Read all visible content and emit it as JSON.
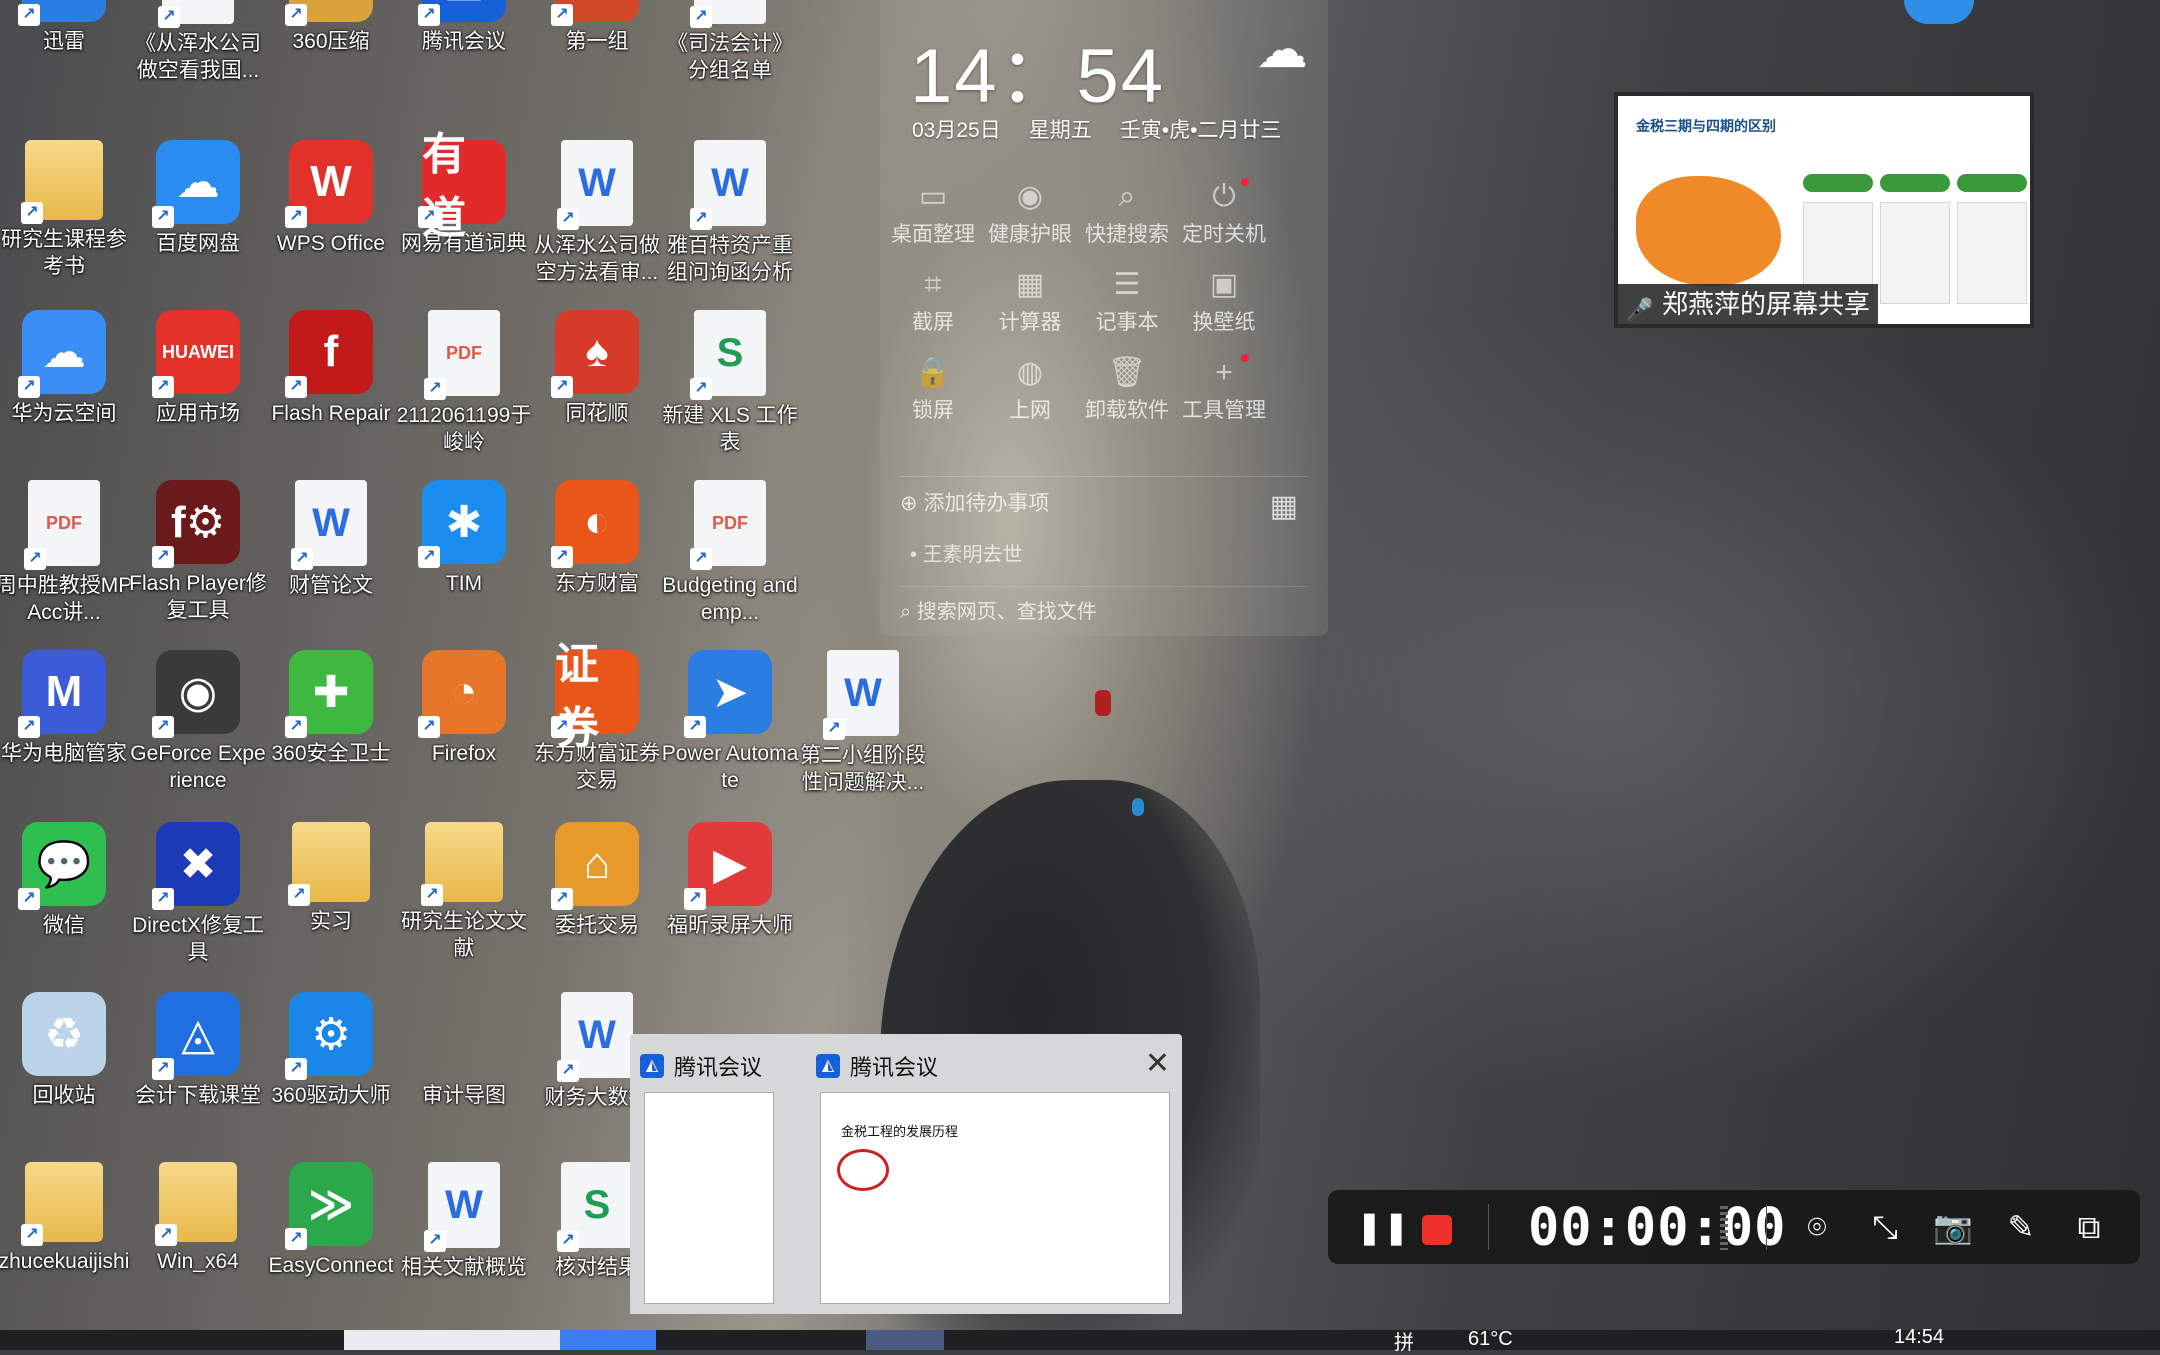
{
  "desktop_icons": [
    {
      "label": "迅雷",
      "icon": "xunlei-icon",
      "color": "#2a7de1",
      "glyph": "➤"
    },
    {
      "label": "《从浑水公司做空看我国...",
      "icon": "word-doc-icon",
      "color": "#2b6ce0",
      "glyph": "W"
    },
    {
      "label": "360压缩",
      "icon": "360zip-icon",
      "color": "#d9a23a",
      "glyph": "ZIP"
    },
    {
      "label": "腾讯会议",
      "icon": "tencent-meeting-icon",
      "color": "#1660d8",
      "glyph": "◭"
    },
    {
      "label": "第一组",
      "icon": "ppt-icon",
      "color": "#d24726",
      "glyph": "P"
    },
    {
      "label": "《司法会计》分组名单",
      "icon": "excel-doc-icon",
      "color": "#1f9d55",
      "glyph": "S"
    },
    {
      "label": "研究生课程参考书",
      "icon": "folder-icon",
      "color": "#e8b94a",
      "glyph": ""
    },
    {
      "label": "百度网盘",
      "icon": "baidu-netdisk-icon",
      "color": "#2a8cf0",
      "glyph": "☁"
    },
    {
      "label": "WPS Office",
      "icon": "wps-icon",
      "color": "#e0322b",
      "glyph": "W"
    },
    {
      "label": "网易有道词典",
      "icon": "youdao-icon",
      "color": "#e32a2a",
      "glyph": "有道"
    },
    {
      "label": "从浑水公司做空方法看审...",
      "icon": "word-doc-icon",
      "color": "#2b6ce0",
      "glyph": "W"
    },
    {
      "label": "雅百特资产重组问询函分析",
      "icon": "word-doc-icon",
      "color": "#2b6ce0",
      "glyph": "W"
    },
    {
      "label": "华为云空间",
      "icon": "huawei-cloud-icon",
      "color": "#3a8ef6",
      "glyph": "☁"
    },
    {
      "label": "应用市场",
      "icon": "huawei-appmarket-icon",
      "color": "#e4322b",
      "glyph": "HUAWEI"
    },
    {
      "label": "Flash Repair",
      "icon": "flash-repair-icon",
      "color": "#c21a1a",
      "glyph": "f"
    },
    {
      "label": "2112061199于峻岭",
      "icon": "pdf-icon",
      "color": "#e05a4a",
      "glyph": "PDF"
    },
    {
      "label": "同花顺",
      "icon": "tonghuashun-icon",
      "color": "#d83a2a",
      "glyph": "♠"
    },
    {
      "label": "新建 XLS 工作表",
      "icon": "excel-doc-icon",
      "color": "#1f9d55",
      "glyph": "S"
    },
    {
      "label": "周中胜教授MPAcc讲...",
      "icon": "pdf-icon",
      "color": "#e05a4a",
      "glyph": "PDF"
    },
    {
      "label": "Flash Player修复工具",
      "icon": "flash-player-repair-icon",
      "color": "#6a1a1a",
      "glyph": "f⚙"
    },
    {
      "label": "财管论文",
      "icon": "word-doc-icon",
      "color": "#2b6ce0",
      "glyph": "W"
    },
    {
      "label": "TIM",
      "icon": "tim-icon",
      "color": "#1b8cf0",
      "glyph": "✱"
    },
    {
      "label": "东方财富",
      "icon": "eastmoney-icon",
      "color": "#e8561a",
      "glyph": "◐"
    },
    {
      "label": "Budgeting and emp...",
      "icon": "pdf-icon",
      "color": "#e05a4a",
      "glyph": "PDF"
    },
    {
      "label": "华为电脑管家",
      "icon": "huawei-pc-manager-icon",
      "color": "#3b5bd8",
      "glyph": "M"
    },
    {
      "label": "GeForce Experience",
      "icon": "geforce-icon",
      "color": "#3a3a3a",
      "glyph": "◉"
    },
    {
      "label": "360安全卫士",
      "icon": "360-safe-icon",
      "color": "#3fb83f",
      "glyph": "✚"
    },
    {
      "label": "Firefox",
      "icon": "firefox-icon",
      "color": "#e8762a",
      "glyph": "◔"
    },
    {
      "label": "东方财富证券交易",
      "icon": "eastmoney-securities-icon",
      "color": "#e8561a",
      "glyph": "证券"
    },
    {
      "label": "Power Automate",
      "icon": "power-automate-icon",
      "color": "#2a7de1",
      "glyph": "➤"
    },
    {
      "label": "第二小组阶段性问题解决...",
      "icon": "word-doc-icon",
      "color": "#2b6ce0",
      "glyph": "W"
    },
    {
      "label": "微信",
      "icon": "wechat-icon",
      "color": "#2fbf50",
      "glyph": "💬"
    },
    {
      "label": "DirectX修复工具",
      "icon": "directx-repair-icon",
      "color": "#1a3ab8",
      "glyph": "✖"
    },
    {
      "label": "实习",
      "icon": "folder-icon",
      "color": "#e8b94a",
      "glyph": ""
    },
    {
      "label": "研究生论文文献",
      "icon": "folder-icon",
      "color": "#e8b94a",
      "glyph": ""
    },
    {
      "label": "委托交易",
      "icon": "entrust-trade-icon",
      "color": "#e89a2a",
      "glyph": "⌂"
    },
    {
      "label": "福昕录屏大师",
      "icon": "foxit-recorder-icon",
      "color": "#e23a3a",
      "glyph": "▶"
    },
    {
      "label": "回收站",
      "icon": "recycle-bin-icon",
      "color": "#bcd4ea",
      "glyph": "♻"
    },
    {
      "label": "会计下载课堂",
      "icon": "accounting-class-icon",
      "color": "#1f6fe0",
      "glyph": "◬"
    },
    {
      "label": "360驱动大师",
      "icon": "360-driver-icon",
      "color": "#1a86e8",
      "glyph": "⚙"
    },
    {
      "label": "审计导图",
      "icon": "blank-icon",
      "color": "transparent",
      "glyph": ""
    },
    {
      "label": "财务大数据",
      "icon": "word-doc-icon",
      "color": "#2b6ce0",
      "glyph": "W"
    },
    {
      "label": "zhucekuaijishi",
      "icon": "folder-icon",
      "color": "#e8b94a",
      "glyph": ""
    },
    {
      "label": "Win_x64",
      "icon": "folder-icon",
      "color": "#e8b94a",
      "glyph": ""
    },
    {
      "label": "EasyConnect",
      "icon": "easyconnect-icon",
      "color": "#2aa84a",
      "glyph": "≫"
    },
    {
      "label": "相关文献概览",
      "icon": "word-doc-icon",
      "color": "#2b6ce0",
      "glyph": "W"
    },
    {
      "label": "核对结果",
      "icon": "excel-doc-icon",
      "color": "#1f9d55",
      "glyph": "S"
    }
  ],
  "widget": {
    "time": "14：54",
    "date": "03月25日",
    "weekday": "星期五",
    "lunar": "壬寅•虎•二月廿三",
    "tools": [
      {
        "label": "桌面整理",
        "icon": "desktop-organize-icon",
        "glyph": "▭"
      },
      {
        "label": "健康护眼",
        "icon": "eye-care-icon",
        "glyph": "◉"
      },
      {
        "label": "快捷搜索",
        "icon": "search-icon",
        "glyph": "⌕"
      },
      {
        "label": "定时关机",
        "icon": "power-icon",
        "glyph": "⏻"
      },
      {
        "label": "截屏",
        "icon": "crop-icon",
        "glyph": "⌗"
      },
      {
        "label": "计算器",
        "icon": "calculator-icon",
        "glyph": "▦"
      },
      {
        "label": "记事本",
        "icon": "notepad-icon",
        "glyph": "☰"
      },
      {
        "label": "换壁纸",
        "icon": "wallpaper-icon",
        "glyph": "▣"
      },
      {
        "label": "锁屏",
        "icon": "lock-icon",
        "glyph": "🔒"
      },
      {
        "label": "上网",
        "icon": "globe-icon",
        "glyph": "◍"
      },
      {
        "label": "卸载软件",
        "icon": "trash-icon",
        "glyph": "🗑"
      },
      {
        "label": "工具管理",
        "icon": "plus-icon",
        "glyph": "+"
      }
    ],
    "todo_add": "添加待办事项",
    "todo_item": "王素明去世",
    "search_placeholder": "搜索网页、查找文件"
  },
  "screen_share": {
    "label": "郑燕萍的屏幕共享",
    "slide_title": "金税三期与四期的区别"
  },
  "taskbar_popup": {
    "items": [
      {
        "title": "腾讯会议"
      },
      {
        "title": "腾讯会议",
        "slide_heading": "金税工程的发展历程"
      }
    ]
  },
  "recorder": {
    "time": "00:00:00"
  },
  "taskbar": {
    "temperature": "61°C",
    "clock": "14:54",
    "ime": "拼"
  },
  "colors": {
    "recorder_stop": "#f0312b",
    "meeting_blue": "#1660d8"
  }
}
